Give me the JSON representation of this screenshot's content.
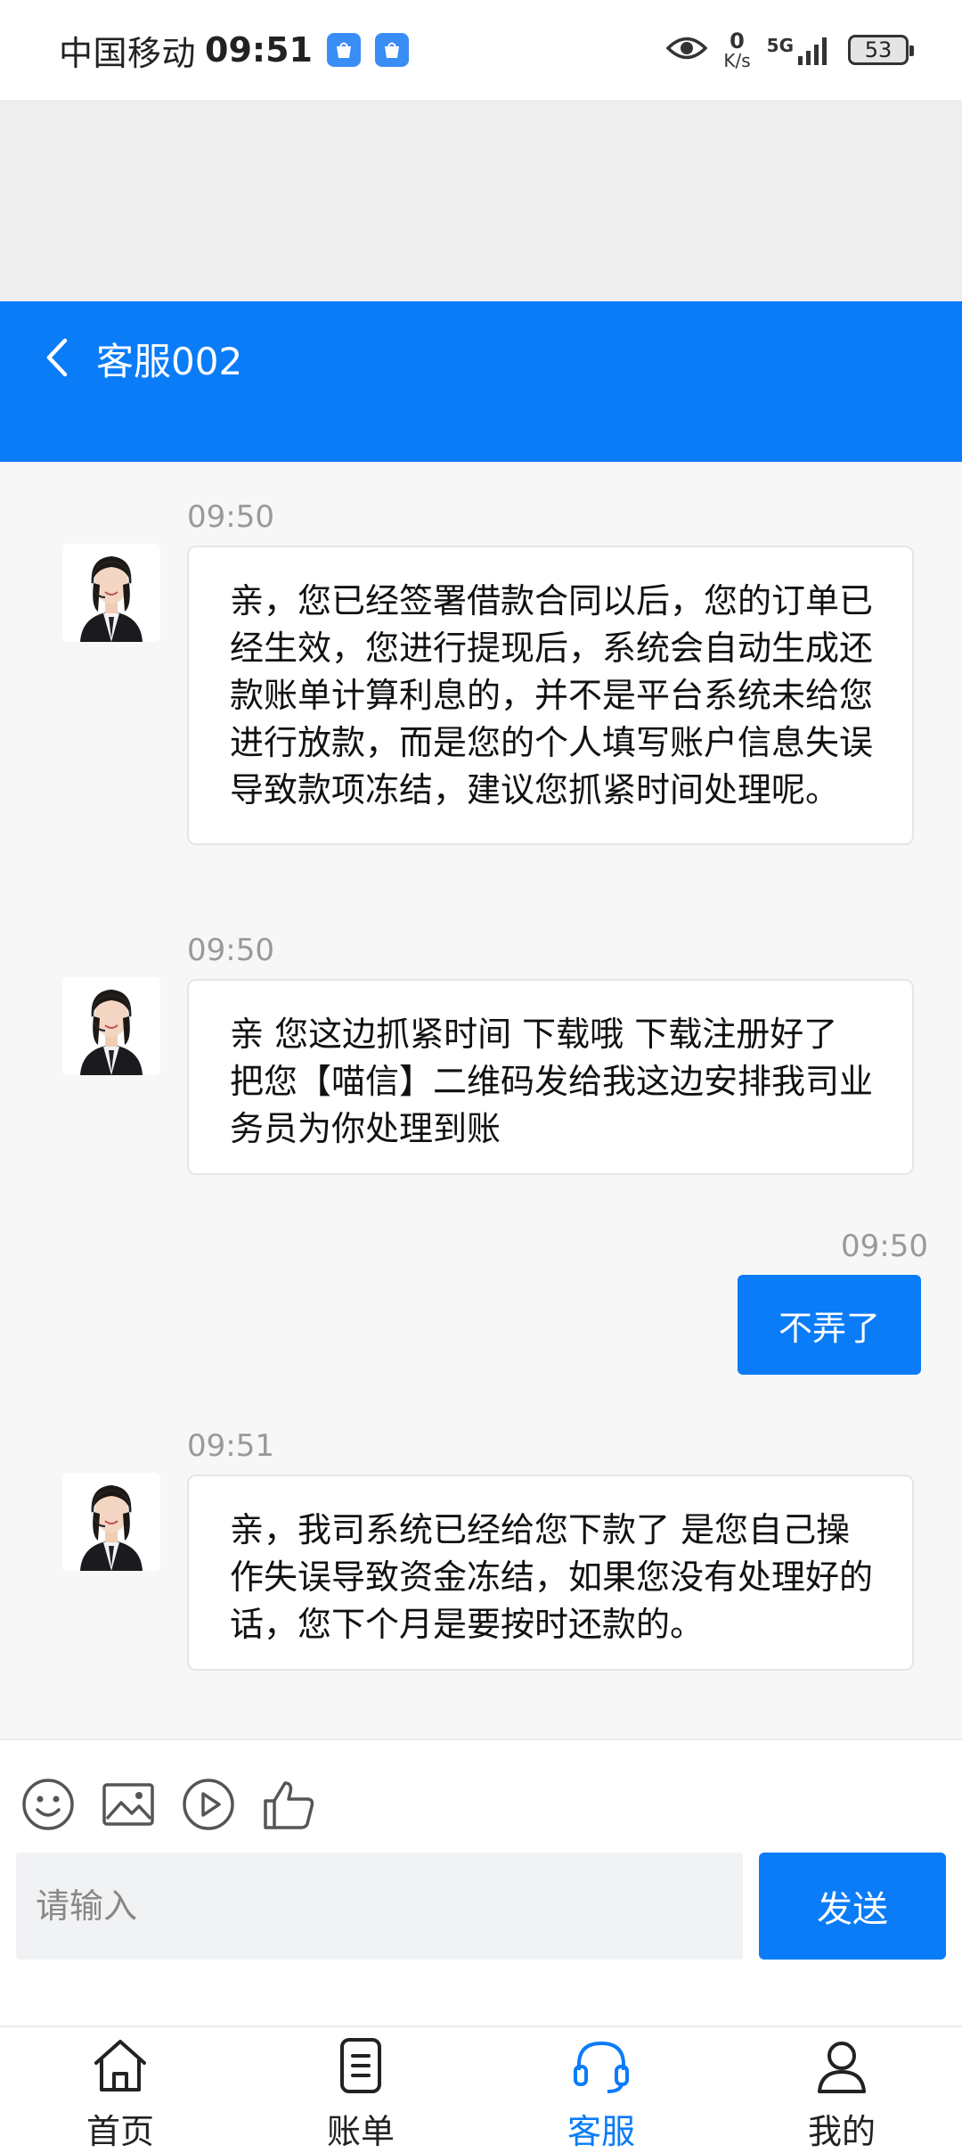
{
  "status_bar": {
    "carrier": "中国移动",
    "time": "09:51",
    "net_speed_value": "0",
    "net_speed_unit": "K/s",
    "network": "5G",
    "battery": "53"
  },
  "header": {
    "title": "客服002",
    "back_icon": "chevron-left-icon"
  },
  "messages": [
    {
      "time": "09:50",
      "direction": "incoming",
      "text": "亲，您已经签署借款合同以后，您的订单已经生效，您进行提现后，系统会自动生成还款账单计算利息的，并不是平台系统未给您进行放款，而是您的个人填写账户信息失误导致款项冻结，建议您抓紧时间处理呢。"
    },
    {
      "time": "09:50",
      "direction": "incoming",
      "text": "亲 您这边抓紧时间 下载哦 下载注册好了 把您【喵信】二维码发给我这边安排我司业务员为你处理到账"
    },
    {
      "time": "09:50",
      "direction": "outgoing",
      "text": "不弄了"
    },
    {
      "time": "09:51",
      "direction": "incoming",
      "text": "亲，我司系统已经给您下款了 是您自己操作失误导致资金冻结，如果您没有处理好的话，您下个月是要按时还款的。"
    }
  ],
  "composer": {
    "placeholder": "请输入",
    "send_label": "发送",
    "tools": [
      "smiley-icon",
      "image-icon",
      "play-icon",
      "thumbs-up-icon"
    ]
  },
  "bottom_nav": {
    "items": [
      {
        "label": "首页",
        "icon": "home-icon"
      },
      {
        "label": "账单",
        "icon": "bill-icon"
      },
      {
        "label": "客服",
        "icon": "headset-icon",
        "active": true
      },
      {
        "label": "我的",
        "icon": "user-icon"
      }
    ]
  },
  "colors": {
    "primary": "#0a7cf8",
    "background": "#f7f7f7"
  }
}
